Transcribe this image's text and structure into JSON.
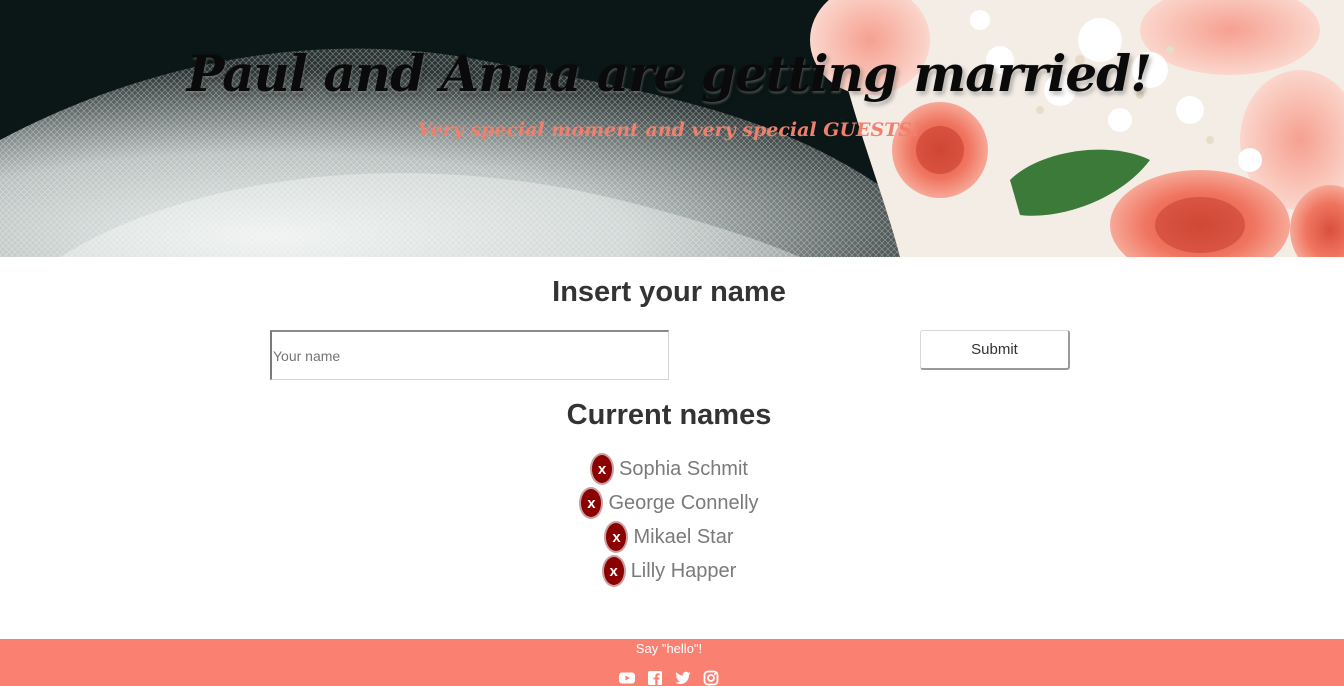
{
  "hero": {
    "title": "Paul and Anna are getting married!",
    "subtitle": "Very special moment and very special GUESTS!"
  },
  "form": {
    "heading": "Insert your name",
    "input_placeholder": "Your name",
    "input_value": "",
    "submit_label": "Submit"
  },
  "names": {
    "heading": "Current names",
    "remove_label": "x",
    "items": [
      {
        "name": "Sophia Schmit"
      },
      {
        "name": "George Connelly"
      },
      {
        "name": "Mikael Star"
      },
      {
        "name": "Lilly Happer"
      }
    ]
  },
  "footer": {
    "text": "Say \"hello\"!",
    "social_icons": [
      "youtube-icon",
      "facebook-icon",
      "twitter-icon",
      "instagram-icon"
    ]
  },
  "colors": {
    "accent": "#fa8072",
    "remove_button": "#8b0000",
    "subtitle": "#f0806d"
  }
}
